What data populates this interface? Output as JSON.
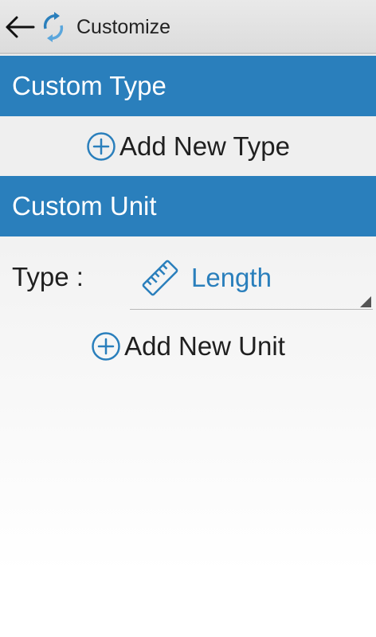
{
  "action_bar": {
    "title": "Customize",
    "back_icon": "arrow-left-icon",
    "app_icon": "refresh-arrows-icon"
  },
  "custom_type": {
    "header": "Custom Type",
    "add_button_label": "Add New Type",
    "add_icon": "plus-circle-icon"
  },
  "custom_unit": {
    "header": "Custom Unit",
    "type_label": "Type :",
    "type_spinner": {
      "selected_value": "Length",
      "icon": "ruler-icon"
    },
    "add_button_label": "Add New Unit",
    "add_icon": "plus-circle-icon"
  },
  "colors": {
    "accent": "#2a7fbc",
    "header_text": "#ffffff",
    "action_bar_bg": "#e3e3e3"
  }
}
